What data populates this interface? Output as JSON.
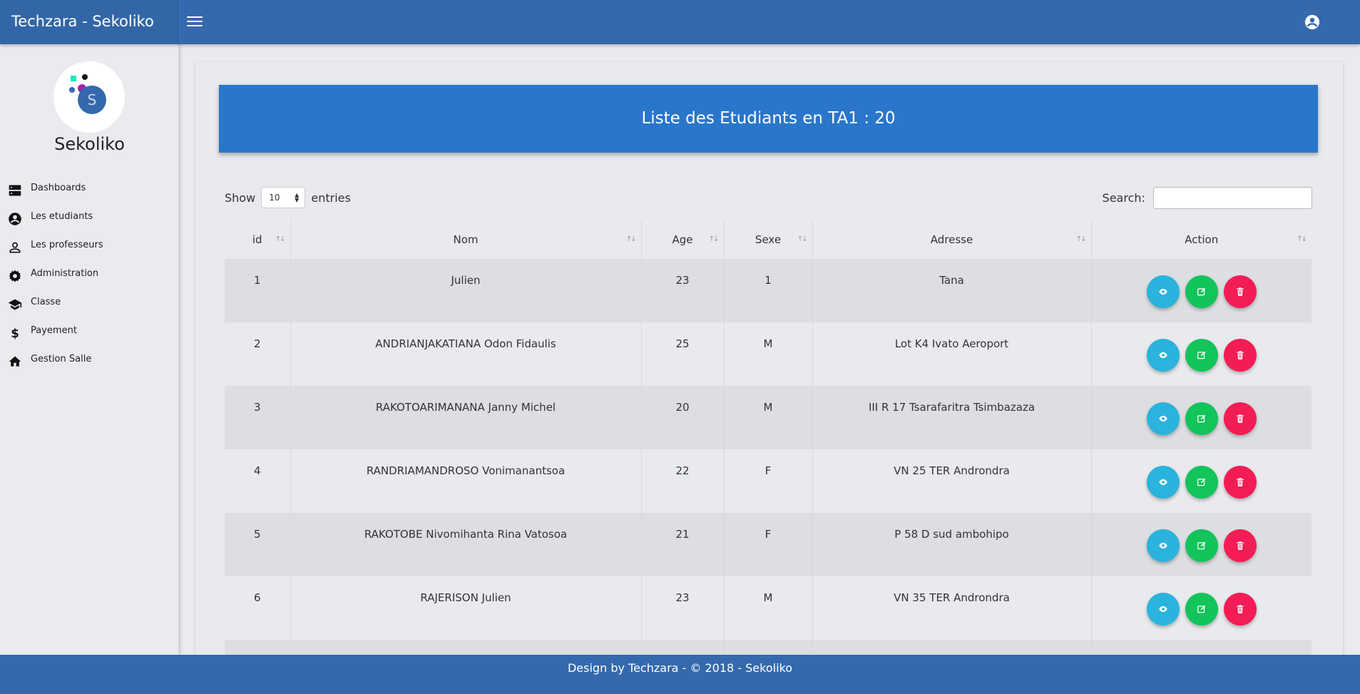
{
  "app": {
    "brand": "Techzara - Sekoliko"
  },
  "sidebar": {
    "logo_name": "Sekoliko",
    "items": [
      {
        "label": "Dashboards",
        "icon": "dashboard-icon"
      },
      {
        "label": "Les etudiants",
        "icon": "account-circle-icon"
      },
      {
        "label": "Les professeurs",
        "icon": "person-icon"
      },
      {
        "label": "Administration",
        "icon": "gear-icon"
      },
      {
        "label": "Classe",
        "icon": "graduation-cap-icon"
      },
      {
        "label": "Payement",
        "icon": "dollar-icon"
      },
      {
        "label": "Gestion Salle",
        "icon": "home-icon"
      }
    ]
  },
  "main": {
    "title": "Liste des Etudiants en TA1 : 20",
    "show_label": "Show",
    "entries_value": "10",
    "entries_label": "entries",
    "search_label": "Search:",
    "search_value": ""
  },
  "table": {
    "columns": [
      "id",
      "Nom",
      "Age",
      "Sexe",
      "Adresse",
      "Action"
    ],
    "rows": [
      {
        "id": "1",
        "nom": "Julien",
        "age": "23",
        "sexe": "1",
        "adresse": "Tana"
      },
      {
        "id": "2",
        "nom": "ANDRIANJAKATIANA Odon Fidaulis",
        "age": "25",
        "sexe": "M",
        "adresse": "Lot K4 Ivato Aeroport"
      },
      {
        "id": "3",
        "nom": "RAKOTOARIMANANA Janny Michel",
        "age": "20",
        "sexe": "M",
        "adresse": "III R 17 Tsarafaritra Tsimbazaza"
      },
      {
        "id": "4",
        "nom": "RANDRIAMANDROSO Vonimanantsoa",
        "age": "22",
        "sexe": "F",
        "adresse": "VN 25 TER Androndra"
      },
      {
        "id": "5",
        "nom": "RAKOTOBE Nivomihanta Rina Vatosoa",
        "age": "21",
        "sexe": "F",
        "adresse": "P 58 D sud ambohipo"
      },
      {
        "id": "6",
        "nom": "RAJERISON Julien",
        "age": "23",
        "sexe": "M",
        "adresse": "VN 35 TER Androndra"
      }
    ]
  },
  "colors": {
    "topbar": "#3569ad",
    "banner": "#2a76cb",
    "view": "#2ab3dd",
    "edit": "#12c45a",
    "delete": "#f41c55"
  },
  "footer": {
    "text": "Design by Techzara - © 2018 - Sekoliko"
  }
}
